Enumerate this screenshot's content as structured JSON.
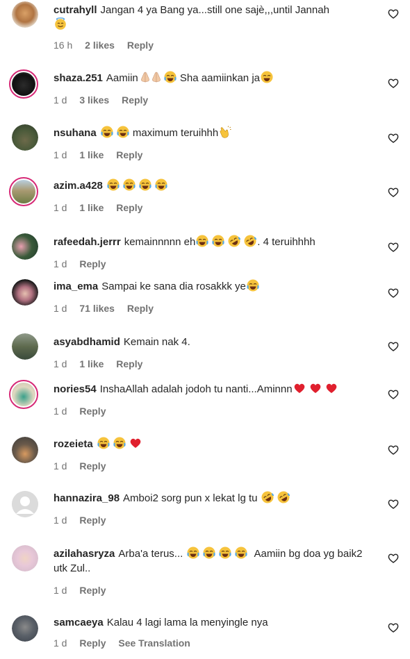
{
  "comments": [
    {
      "user": "cutrahyll",
      "text": "Jangan 4 ya Bang ya...still one sajè,,,until Jannah",
      "time": "16 h",
      "likes": "2 likes",
      "reply": "Reply"
    },
    {
      "user": "shaza.251",
      "text": "Aamiin",
      "text2": "Sha aamiinkan ja",
      "time": "1 d",
      "likes": "3 likes",
      "reply": "Reply"
    },
    {
      "user": "nsuhana",
      "text": "maximum teruihhh",
      "time": "1 d",
      "likes": "1 like",
      "reply": "Reply"
    },
    {
      "user": "azim.a428",
      "text": "",
      "time": "1 d",
      "likes": "1 like",
      "reply": "Reply"
    },
    {
      "user": "rafeedah.jerrr",
      "text": "kemainnnnn eh",
      "text2": ". 4 teruihhhh",
      "time": "1 d",
      "reply": "Reply"
    },
    {
      "user": "ima_ema",
      "text": "Sampai ke sana dia rosakkk ye",
      "time": "1 d",
      "likes": "71 likes",
      "reply": "Reply"
    },
    {
      "user": "asyabdhamid",
      "text": "Kemain nak 4.",
      "time": "1 d",
      "likes": "1 like",
      "reply": "Reply"
    },
    {
      "user": "nories54",
      "text": "InshaAllah adalah jodoh tu nanti...Aminnn",
      "time": "1 d",
      "reply": "Reply"
    },
    {
      "user": "rozeieta",
      "text": "",
      "time": "1 d",
      "reply": "Reply"
    },
    {
      "user": "hannazira_98",
      "text": "Amboi2 sorg pun x lekat lg tu",
      "time": "1 d",
      "reply": "Reply"
    },
    {
      "user": "azilahasryza",
      "text": "Arba'a terus...",
      "text2": "Aamiin bg doa yg baik2 utk Zul..",
      "time": "1 d",
      "reply": "Reply"
    },
    {
      "user": "samcaeya",
      "text": "Kalau 4 lagi lama la menyingle nya",
      "time": "1 d",
      "reply": "Reply",
      "translate": "See Translation"
    }
  ],
  "icons": {
    "heart": "heart-outline-icon",
    "laugh": "face-with-tears-of-joy-emoji",
    "angel": "smiling-face-with-halo-emoji",
    "clap": "clapping-hands-emoji",
    "rofl": "rolling-on-floor-laughing-emoji",
    "red_heart": "red-heart-emoji",
    "pray": "folded-hands-emoji",
    "grin": "grinning-face-emoji"
  },
  "colors": {
    "text": "#262626",
    "meta": "#737373",
    "story_ring": "#d62976",
    "emoji": "#f5c33b",
    "heart_emoji": "#e0202e"
  }
}
